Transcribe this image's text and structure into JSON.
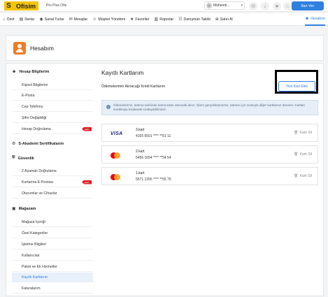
{
  "topbar": {
    "logo_letter": "S",
    "logo_text": "Ofisim",
    "plan": "Pro Plus Ofis",
    "user_initials": "M",
    "user_name": "Mühendi...",
    "post_ad_label": "İlan Ver"
  },
  "nav": {
    "items": [
      {
        "label": "Özet",
        "icon": "home-icon"
      },
      {
        "label": "İlanlar",
        "icon": "list-icon"
      },
      {
        "label": "Sanal Turlar",
        "icon": "tour-icon"
      },
      {
        "label": "Mesajlar",
        "icon": "message-icon"
      },
      {
        "label": "Müşteri Yönetimi",
        "icon": "users-icon"
      },
      {
        "label": "Favoriler",
        "icon": "star-icon"
      },
      {
        "label": "Raporlar",
        "icon": "chart-icon"
      },
      {
        "label": "Danışman Takibi",
        "icon": "team-icon"
      },
      {
        "label": "Satın Al",
        "icon": "cart-icon"
      },
      {
        "label": "Hesabım",
        "icon": "account-icon"
      }
    ]
  },
  "header": {
    "title": "Hesabım"
  },
  "sidebar": {
    "sections": [
      {
        "title": "Hesap Bilgilerim",
        "items": [
          "Kişisel Bilgilerim",
          "E-Posta",
          "Cep Telefonu",
          "Şifre Değişikliği",
          "Hesap Doğrulama"
        ]
      },
      {
        "title": "S-Akademi Sertifikalarım",
        "items": []
      },
      {
        "title": "Güvenlik",
        "items": [
          "2 Aşamalı Doğrulama",
          "Kurtarma E-Postası",
          "Oturumlar ve Cihazlar"
        ]
      },
      {
        "title": "Mağazam",
        "items": [
          "Mağaza İçeriği",
          "Özel Kategoriler",
          "İşletme Bilgileri",
          "Kullanıcılar",
          "Paket ve Ek Hizmetler",
          "Kayıtlı Kartlarım",
          "Faturalarım"
        ]
      }
    ],
    "badge": "yeni",
    "active_item": "Kayıtlı Kartlarım"
  },
  "content": {
    "title": "Kayıtlı Kartlarım",
    "subtitle": "Ödemelerimin Alınacağı Kredi Kartlarım",
    "add_card_label": "Yeni Kart Ekle",
    "info_text": "Ödemeleriniz, ödeme tarihinde kartınızdan otomatik alınır. İşlem gerçekleşmezse, ödeme için sırasıyla diğer kartlarınız denenir. Kartları sürükleyip bırakarak sıralayabilirsiniz.",
    "delete_label": "Kartı Sil",
    "cards": [
      {
        "name": "3.kart",
        "number": "4155 6501 **** **61 11",
        "brand": "visa",
        "brand_text": "VISA"
      },
      {
        "name": "2.kart",
        "number": "5456 1654 **** **54 54",
        "brand": "mastercard"
      },
      {
        "name": "1.kart",
        "number": "5571 1355 **** **55 75",
        "brand": "mastercard"
      }
    ]
  },
  "colors": {
    "accent": "#2f7fe0",
    "logo": "#f5c400",
    "header_icon": "#f07c22",
    "badge": "#e01c24"
  }
}
